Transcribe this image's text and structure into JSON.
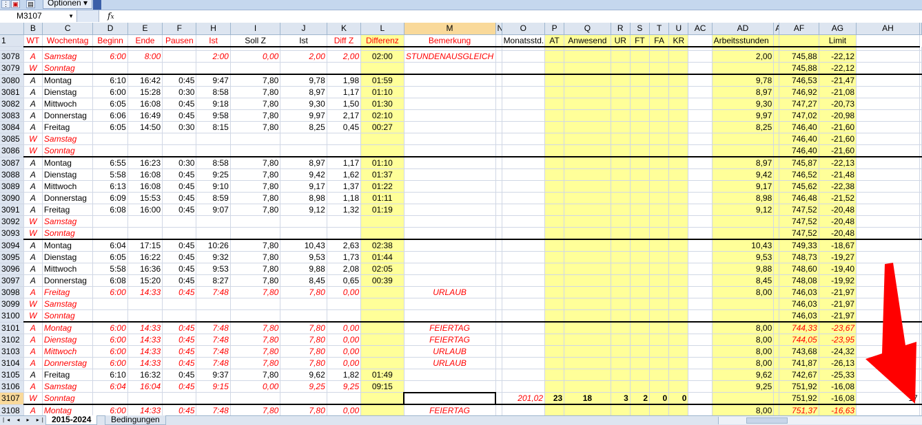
{
  "toolbar": {
    "options_label": "Optionen"
  },
  "formula_bar": {
    "name_box": "M3107",
    "fx": "fx",
    "content": ""
  },
  "columns": [
    "",
    "B",
    "C",
    "D",
    "E",
    "F",
    "H",
    "I",
    "J",
    "K",
    "L",
    "M",
    "N",
    "O",
    "P",
    "Q",
    "R",
    "S",
    "T",
    "U",
    "AC",
    "AD",
    "AE",
    "AF",
    "AG",
    "AH",
    ""
  ],
  "header_row": {
    "row_num": "1",
    "cells": [
      "WT",
      "Wochentag",
      "Beginn",
      "Ende",
      "Pausen",
      "Ist",
      "Soll Z",
      "Ist",
      "Diff Z",
      "Differenz",
      "Bemerkung",
      "",
      "Monatsstd.",
      "AT",
      "Anwesend",
      "UR",
      "FT",
      "FA",
      "KR",
      "",
      "Arbeitsstunden",
      "",
      "",
      "Limit",
      ""
    ]
  },
  "rows": [
    {
      "n": "3078",
      "style": "red",
      "wt": "A",
      "day": "Samstag",
      "beg": "6:00",
      "end": "8:00",
      "pause": "",
      "ist": "2:00",
      "soll": "0,00",
      "istd": "2,00",
      "diff": "2,00",
      "dz": "02:00",
      "bem": "STUNDENAUSGLEICH",
      "ad": "2,00",
      "af": "745,88",
      "ag": "-22,12"
    },
    {
      "n": "3079",
      "style": "redw",
      "wt": "W",
      "day": "Sonntag",
      "beg": "",
      "end": "",
      "pause": "",
      "ist": "",
      "soll": "",
      "istd": "",
      "diff": "",
      "dz": "",
      "bem": "",
      "ad": "",
      "af": "745,88",
      "ag": "-22,12",
      "thick": true
    },
    {
      "n": "3080",
      "style": "norm",
      "wt": "A",
      "day": "Montag",
      "beg": "6:10",
      "end": "16:42",
      "pause": "0:45",
      "ist": "9:47",
      "soll": "7,80",
      "istd": "9,78",
      "diff": "1,98",
      "dz": "01:59",
      "bem": "",
      "ad": "9,78",
      "af": "746,53",
      "ag": "-21,47"
    },
    {
      "n": "3081",
      "style": "norm",
      "wt": "A",
      "day": "Dienstag",
      "beg": "6:00",
      "end": "15:28",
      "pause": "0:30",
      "ist": "8:58",
      "soll": "7,80",
      "istd": "8,97",
      "diff": "1,17",
      "dz": "01:10",
      "bem": "",
      "ad": "8,97",
      "af": "746,92",
      "ag": "-21,08"
    },
    {
      "n": "3082",
      "style": "norm",
      "wt": "A",
      "day": "Mittwoch",
      "beg": "6:05",
      "end": "16:08",
      "pause": "0:45",
      "ist": "9:18",
      "soll": "7,80",
      "istd": "9,30",
      "diff": "1,50",
      "dz": "01:30",
      "bem": "",
      "ad": "9,30",
      "af": "747,27",
      "ag": "-20,73"
    },
    {
      "n": "3083",
      "style": "norm",
      "wt": "A",
      "day": "Donnerstag",
      "beg": "6:06",
      "end": "16:49",
      "pause": "0:45",
      "ist": "9:58",
      "soll": "7,80",
      "istd": "9,97",
      "diff": "2,17",
      "dz": "02:10",
      "bem": "",
      "ad": "9,97",
      "af": "747,02",
      "ag": "-20,98"
    },
    {
      "n": "3084",
      "style": "norm",
      "wt": "A",
      "day": "Freitag",
      "beg": "6:05",
      "end": "14:50",
      "pause": "0:30",
      "ist": "8:15",
      "soll": "7,80",
      "istd": "8,25",
      "diff": "0,45",
      "dz": "00:27",
      "bem": "",
      "ad": "8,25",
      "af": "746,40",
      "ag": "-21,60"
    },
    {
      "n": "3085",
      "style": "redw",
      "wt": "W",
      "day": "Samstag",
      "beg": "",
      "end": "",
      "pause": "",
      "ist": "",
      "soll": "",
      "istd": "",
      "diff": "",
      "dz": "",
      "bem": "",
      "ad": "",
      "af": "746,40",
      "ag": "-21,60"
    },
    {
      "n": "3086",
      "style": "redw",
      "wt": "W",
      "day": "Sonntag",
      "beg": "",
      "end": "",
      "pause": "",
      "ist": "",
      "soll": "",
      "istd": "",
      "diff": "",
      "dz": "",
      "bem": "",
      "ad": "",
      "af": "746,40",
      "ag": "-21,60",
      "thick": true
    },
    {
      "n": "3087",
      "style": "norm",
      "wt": "A",
      "day": "Montag",
      "beg": "6:55",
      "end": "16:23",
      "pause": "0:30",
      "ist": "8:58",
      "soll": "7,80",
      "istd": "8,97",
      "diff": "1,17",
      "dz": "01:10",
      "bem": "",
      "ad": "8,97",
      "af": "745,87",
      "ag": "-22,13"
    },
    {
      "n": "3088",
      "style": "norm",
      "wt": "A",
      "day": "Dienstag",
      "beg": "5:58",
      "end": "16:08",
      "pause": "0:45",
      "ist": "9:25",
      "soll": "7,80",
      "istd": "9,42",
      "diff": "1,62",
      "dz": "01:37",
      "bem": "",
      "ad": "9,42",
      "af": "746,52",
      "ag": "-21,48"
    },
    {
      "n": "3089",
      "style": "norm",
      "wt": "A",
      "day": "Mittwoch",
      "beg": "6:13",
      "end": "16:08",
      "pause": "0:45",
      "ist": "9:10",
      "soll": "7,80",
      "istd": "9,17",
      "diff": "1,37",
      "dz": "01:22",
      "bem": "",
      "ad": "9,17",
      "af": "745,62",
      "ag": "-22,38"
    },
    {
      "n": "3090",
      "style": "norm",
      "wt": "A",
      "day": "Donnerstag",
      "beg": "6:09",
      "end": "15:53",
      "pause": "0:45",
      "ist": "8:59",
      "soll": "7,80",
      "istd": "8,98",
      "diff": "1,18",
      "dz": "01:11",
      "bem": "",
      "ad": "8,98",
      "af": "746,48",
      "ag": "-21,52"
    },
    {
      "n": "3091",
      "style": "norm",
      "wt": "A",
      "day": "Freitag",
      "beg": "6:08",
      "end": "16:00",
      "pause": "0:45",
      "ist": "9:07",
      "soll": "7,80",
      "istd": "9,12",
      "diff": "1,32",
      "dz": "01:19",
      "bem": "",
      "ad": "9,12",
      "af": "747,52",
      "ag": "-20,48"
    },
    {
      "n": "3092",
      "style": "redw",
      "wt": "W",
      "day": "Samstag",
      "beg": "",
      "end": "",
      "pause": "",
      "ist": "",
      "soll": "",
      "istd": "",
      "diff": "",
      "dz": "",
      "bem": "",
      "ad": "",
      "af": "747,52",
      "ag": "-20,48"
    },
    {
      "n": "3093",
      "style": "redw",
      "wt": "W",
      "day": "Sonntag",
      "beg": "",
      "end": "",
      "pause": "",
      "ist": "",
      "soll": "",
      "istd": "",
      "diff": "",
      "dz": "",
      "bem": "",
      "ad": "",
      "af": "747,52",
      "ag": "-20,48",
      "thick": true
    },
    {
      "n": "3094",
      "style": "norm",
      "wt": "A",
      "day": "Montag",
      "beg": "6:04",
      "end": "17:15",
      "pause": "0:45",
      "ist": "10:26",
      "soll": "7,80",
      "istd": "10,43",
      "diff": "2,63",
      "dz": "02:38",
      "bem": "",
      "ad": "10,43",
      "af": "749,33",
      "ag": "-18,67"
    },
    {
      "n": "3095",
      "style": "norm",
      "wt": "A",
      "day": "Dienstag",
      "beg": "6:05",
      "end": "16:22",
      "pause": "0:45",
      "ist": "9:32",
      "soll": "7,80",
      "istd": "9,53",
      "diff": "1,73",
      "dz": "01:44",
      "bem": "",
      "ad": "9,53",
      "af": "748,73",
      "ag": "-19,27"
    },
    {
      "n": "3096",
      "style": "norm",
      "wt": "A",
      "day": "Mittwoch",
      "beg": "5:58",
      "end": "16:36",
      "pause": "0:45",
      "ist": "9:53",
      "soll": "7,80",
      "istd": "9,88",
      "diff": "2,08",
      "dz": "02:05",
      "bem": "",
      "ad": "9,88",
      "af": "748,60",
      "ag": "-19,40"
    },
    {
      "n": "3097",
      "style": "norm",
      "wt": "A",
      "day": "Donnerstag",
      "beg": "6:08",
      "end": "15:20",
      "pause": "0:45",
      "ist": "8:27",
      "soll": "7,80",
      "istd": "8,45",
      "diff": "0,65",
      "dz": "00:39",
      "bem": "",
      "ad": "8,45",
      "af": "748,08",
      "ag": "-19,92"
    },
    {
      "n": "3098",
      "style": "red",
      "wt": "A",
      "day": "Freitag",
      "beg": "6:00",
      "end": "14:33",
      "pause": "0:45",
      "ist": "7:48",
      "soll": "7,80",
      "istd": "7,80",
      "diff": "0,00",
      "dz": "",
      "bem": "URLAUB",
      "ad": "8,00",
      "af": "746,03",
      "ag": "-21,97"
    },
    {
      "n": "3099",
      "style": "redw",
      "wt": "W",
      "day": "Samstag",
      "beg": "",
      "end": "",
      "pause": "",
      "ist": "",
      "soll": "",
      "istd": "",
      "diff": "",
      "dz": "",
      "bem": "",
      "ad": "",
      "af": "746,03",
      "ag": "-21,97"
    },
    {
      "n": "3100",
      "style": "redw",
      "wt": "W",
      "day": "Sonntag",
      "beg": "",
      "end": "",
      "pause": "",
      "ist": "",
      "soll": "",
      "istd": "",
      "diff": "",
      "dz": "",
      "bem": "",
      "ad": "",
      "af": "746,03",
      "ag": "-21,97",
      "thick": true
    },
    {
      "n": "3101",
      "style": "red",
      "wt": "A",
      "day": "Montag",
      "beg": "6:00",
      "end": "14:33",
      "pause": "0:45",
      "ist": "7:48",
      "soll": "7,80",
      "istd": "7,80",
      "diff": "0,00",
      "dz": "",
      "bem": "FEIERTAG",
      "ad": "8,00",
      "af": "744,33",
      "ag": "-23,67",
      "afred": true
    },
    {
      "n": "3102",
      "style": "red",
      "wt": "A",
      "day": "Dienstag",
      "beg": "6:00",
      "end": "14:33",
      "pause": "0:45",
      "ist": "7:48",
      "soll": "7,80",
      "istd": "7,80",
      "diff": "0,00",
      "dz": "",
      "bem": "FEIERTAG",
      "ad": "8,00",
      "af": "744,05",
      "ag": "-23,95",
      "afred": true
    },
    {
      "n": "3103",
      "style": "red",
      "wt": "A",
      "day": "Mittwoch",
      "beg": "6:00",
      "end": "14:33",
      "pause": "0:45",
      "ist": "7:48",
      "soll": "7,80",
      "istd": "7,80",
      "diff": "0,00",
      "dz": "",
      "bem": "URLAUB",
      "ad": "8,00",
      "af": "743,68",
      "ag": "-24,32"
    },
    {
      "n": "3104",
      "style": "red",
      "wt": "A",
      "day": "Donnerstag",
      "beg": "6:00",
      "end": "14:33",
      "pause": "0:45",
      "ist": "7:48",
      "soll": "7,80",
      "istd": "7,80",
      "diff": "0,00",
      "dz": "",
      "bem": "URLAUB",
      "ad": "8,00",
      "af": "741,87",
      "ag": "-26,13"
    },
    {
      "n": "3105",
      "style": "norm",
      "wt": "A",
      "day": "Freitag",
      "beg": "6:10",
      "end": "16:32",
      "pause": "0:45",
      "ist": "9:37",
      "soll": "7,80",
      "istd": "9,62",
      "diff": "1,82",
      "dz": "01:49",
      "bem": "",
      "ad": "9,62",
      "af": "742,67",
      "ag": "-25,33"
    },
    {
      "n": "3106",
      "style": "red",
      "wt": "A",
      "day": "Samstag",
      "beg": "6:04",
      "end": "16:04",
      "pause": "0:45",
      "ist": "9:15",
      "soll": "0,00",
      "istd": "9,25",
      "diff": "9,25",
      "dz": "09:15",
      "bem": "",
      "ad": "9,25",
      "af": "751,92",
      "ag": "-16,08"
    },
    {
      "n": "3107",
      "style": "redw",
      "wt": "W",
      "day": "Sonntag",
      "beg": "",
      "end": "",
      "pause": "",
      "ist": "",
      "soll": "",
      "istd": "",
      "diff": "",
      "dz": "",
      "bem": "",
      "ad": "",
      "af": "751,92",
      "ag": "-16,08",
      "summary": true,
      "thick": true
    },
    {
      "n": "3108",
      "style": "red",
      "wt": "A",
      "day": "Montag",
      "beg": "6:00",
      "end": "14:33",
      "pause": "0:45",
      "ist": "7:48",
      "soll": "7,80",
      "istd": "7,80",
      "diff": "0,00",
      "dz": "",
      "bem": "FEIERTAG",
      "ad": "8,00",
      "af": "751,37",
      "ag": "-16,63",
      "afred": true
    }
  ],
  "summary_3107": {
    "monatsstd": "201,02",
    "at": "23",
    "anwesend": "18",
    "ur": "3",
    "ft": "2",
    "fa": "0",
    "kr": "0",
    "ah": "17"
  },
  "sheet_tabs": [
    "2015-2024",
    "Bedingungen"
  ],
  "colors": {
    "red": "#ff0000",
    "yellow": "#ffff99",
    "header": "#dde5f0",
    "selected": "#f9d99a"
  }
}
